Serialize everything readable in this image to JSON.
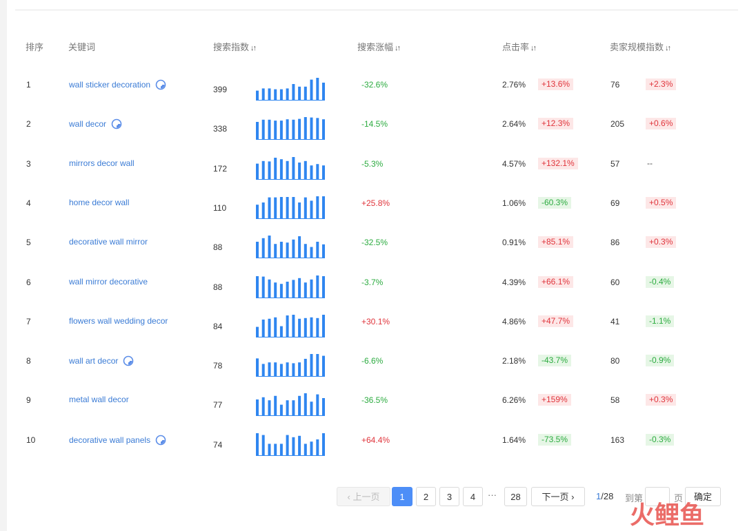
{
  "columns": {
    "rank": "排序",
    "keyword": "关键词",
    "search_index": "搜索指数",
    "search_growth": "搜索涨幅",
    "ctr": "点击率",
    "seller_index": "卖家规模指数"
  },
  "colors": {
    "keyword": "#3a7bd5",
    "bar": "#2f86f0",
    "positive": "#e0343b",
    "positive_bg": "#fde7e7",
    "negative": "#2bab3f",
    "negative_bg": "#e6f6e6",
    "active_page": "#4d8ef7"
  },
  "rows": [
    {
      "rank": "1",
      "keyword": "wall sticker decoration",
      "icon": "moon-icon",
      "search_index": "399",
      "spark": [
        0.42,
        0.52,
        0.52,
        0.48,
        0.48,
        0.52,
        0.72,
        0.6,
        0.6,
        0.92,
        1.0,
        0.78
      ],
      "search_growth": "-32.6%",
      "ctr": "2.76%",
      "ctr_change": "+13.6%",
      "seller_index": "76",
      "seller_change": "+2.3%"
    },
    {
      "rank": "2",
      "keyword": "wall decor",
      "icon": "moon-icon",
      "search_index": "338",
      "spark": [
        0.78,
        0.88,
        0.88,
        0.84,
        0.84,
        0.9,
        0.88,
        0.92,
        1.0,
        0.98,
        0.96,
        0.9
      ],
      "search_growth": "-14.5%",
      "ctr": "2.64%",
      "ctr_change": "+12.3%",
      "seller_index": "205",
      "seller_change": "+0.6%"
    },
    {
      "rank": "3",
      "keyword": "mirrors decor wall",
      "icon": "",
      "search_index": "172",
      "spark": [
        0.7,
        0.82,
        0.8,
        0.97,
        0.9,
        0.82,
        1.0,
        0.75,
        0.82,
        0.62,
        0.68,
        0.62
      ],
      "search_growth": "-5.3%",
      "ctr": "4.57%",
      "ctr_change": "+132.1%",
      "seller_index": "57",
      "seller_change": "--"
    },
    {
      "rank": "4",
      "keyword": "home decor wall",
      "icon": "",
      "search_index": "110",
      "spark": [
        0.62,
        0.72,
        0.95,
        0.95,
        0.97,
        0.97,
        0.97,
        0.72,
        0.95,
        0.8,
        1.0,
        1.0
      ],
      "search_growth": "+25.8%",
      "ctr": "1.06%",
      "ctr_change": "-60.3%",
      "seller_index": "69",
      "seller_change": "+0.5%"
    },
    {
      "rank": "5",
      "keyword": "decorative wall mirror",
      "icon": "",
      "search_index": "88",
      "spark": [
        0.72,
        0.88,
        1.0,
        0.62,
        0.72,
        0.68,
        0.82,
        0.97,
        0.62,
        0.48,
        0.72,
        0.6
      ],
      "search_growth": "-32.5%",
      "ctr": "0.91%",
      "ctr_change": "+85.1%",
      "seller_index": "86",
      "seller_change": "+0.3%"
    },
    {
      "rank": "6",
      "keyword": "wall mirror decorative",
      "icon": "",
      "search_index": "88",
      "spark": [
        0.97,
        0.95,
        0.82,
        0.68,
        0.62,
        0.72,
        0.8,
        0.88,
        0.68,
        0.82,
        1.0,
        0.97
      ],
      "search_growth": "-3.7%",
      "ctr": "4.39%",
      "ctr_change": "+66.1%",
      "seller_index": "60",
      "seller_change": "-0.4%"
    },
    {
      "rank": "7",
      "keyword": "flowers wall wedding decor",
      "icon": "",
      "search_index": "84",
      "spark": [
        0.45,
        0.78,
        0.82,
        0.88,
        0.48,
        0.97,
        1.0,
        0.82,
        0.85,
        0.88,
        0.85,
        1.0
      ],
      "search_growth": "+30.1%",
      "ctr": "4.86%",
      "ctr_change": "+47.7%",
      "seller_index": "41",
      "seller_change": "-1.1%"
    },
    {
      "rank": "8",
      "keyword": "wall art decor",
      "icon": "moon-icon",
      "search_index": "78",
      "spark": [
        0.8,
        0.55,
        0.62,
        0.62,
        0.55,
        0.62,
        0.58,
        0.62,
        0.78,
        1.0,
        1.0,
        0.92
      ],
      "search_growth": "-6.6%",
      "ctr": "2.18%",
      "ctr_change": "-43.7%",
      "seller_index": "80",
      "seller_change": "-0.9%"
    },
    {
      "rank": "9",
      "keyword": "metal wall decor",
      "icon": "",
      "search_index": "77",
      "spark": [
        0.72,
        0.82,
        0.68,
        0.88,
        0.48,
        0.68,
        0.68,
        0.88,
        1.0,
        0.62,
        0.95,
        0.78
      ],
      "search_growth": "-36.5%",
      "ctr": "6.26%",
      "ctr_change": "+159%",
      "seller_index": "58",
      "seller_change": "+0.3%"
    },
    {
      "rank": "10",
      "keyword": "decorative wall panels",
      "icon": "moon-icon",
      "search_index": "74",
      "spark": [
        1.0,
        0.92,
        0.52,
        0.52,
        0.52,
        0.92,
        0.82,
        0.88,
        0.52,
        0.62,
        0.72,
        1.0
      ],
      "search_growth": "+64.4%",
      "ctr": "1.64%",
      "ctr_change": "-73.5%",
      "seller_index": "163",
      "seller_change": "-0.3%"
    }
  ],
  "pagination": {
    "prev_label": "上一页",
    "next_label": "下一页",
    "pages": [
      "1",
      "2",
      "3",
      "4"
    ],
    "ellipsis": "···",
    "last_page": "28",
    "current": "1",
    "total": "/28",
    "goto_label": "到第",
    "page_suffix": "页",
    "confirm_label": "确定",
    "goto_value": ""
  },
  "logo": {
    "text": "火鲤鱼"
  }
}
